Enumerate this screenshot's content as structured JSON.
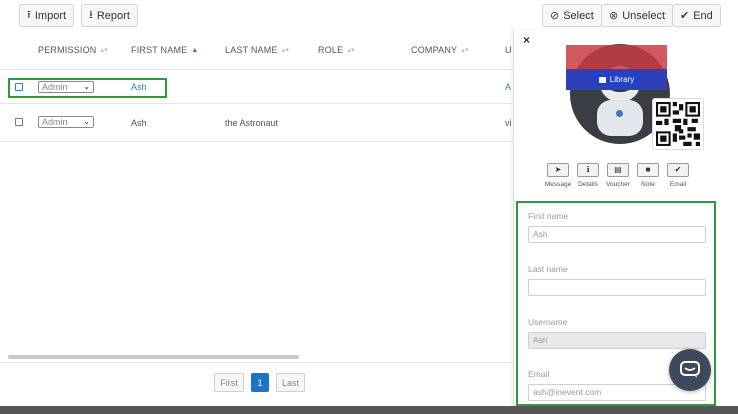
{
  "toolbar": {
    "import_label": "Import",
    "report_label": "Report",
    "select_label": "Select",
    "unselect_label": "Unselect",
    "end_label": "End"
  },
  "table": {
    "columns": [
      "PERMISSION",
      "FIRST NAME",
      "LAST NAME",
      "ROLE",
      "COMPANY",
      "U"
    ],
    "rows": [
      {
        "permission": "Admin",
        "first_name": "Ash",
        "last_name": "",
        "role": "",
        "company": "",
        "u": "A"
      },
      {
        "permission": "Admin",
        "first_name": "Ash",
        "last_name": "the Astronaut",
        "role": "",
        "company": "",
        "u": "vi"
      }
    ]
  },
  "pagination": {
    "first_label": "First",
    "current_page": "1",
    "last_label": "Last"
  },
  "panel": {
    "close_label": "×",
    "library_label": "Library",
    "actions": [
      {
        "label": "Message",
        "icon": "send-icon"
      },
      {
        "label": "Details",
        "icon": "info-icon"
      },
      {
        "label": "Voucher",
        "icon": "voucher-icon"
      },
      {
        "label": "Note",
        "icon": "note-icon"
      },
      {
        "label": "Email",
        "icon": "email-icon"
      }
    ],
    "form": {
      "first_name_label": "First name",
      "first_name_value": "Ash",
      "last_name_label": "Last name",
      "last_name_value": "",
      "username_label": "Username",
      "username_value": "Ash",
      "email_label": "Email",
      "email_value": "ash@inevent.com"
    }
  },
  "colors": {
    "accent": "#1a75c9",
    "highlight": "#2e9a3a",
    "library_band": "#2f3fb8"
  }
}
